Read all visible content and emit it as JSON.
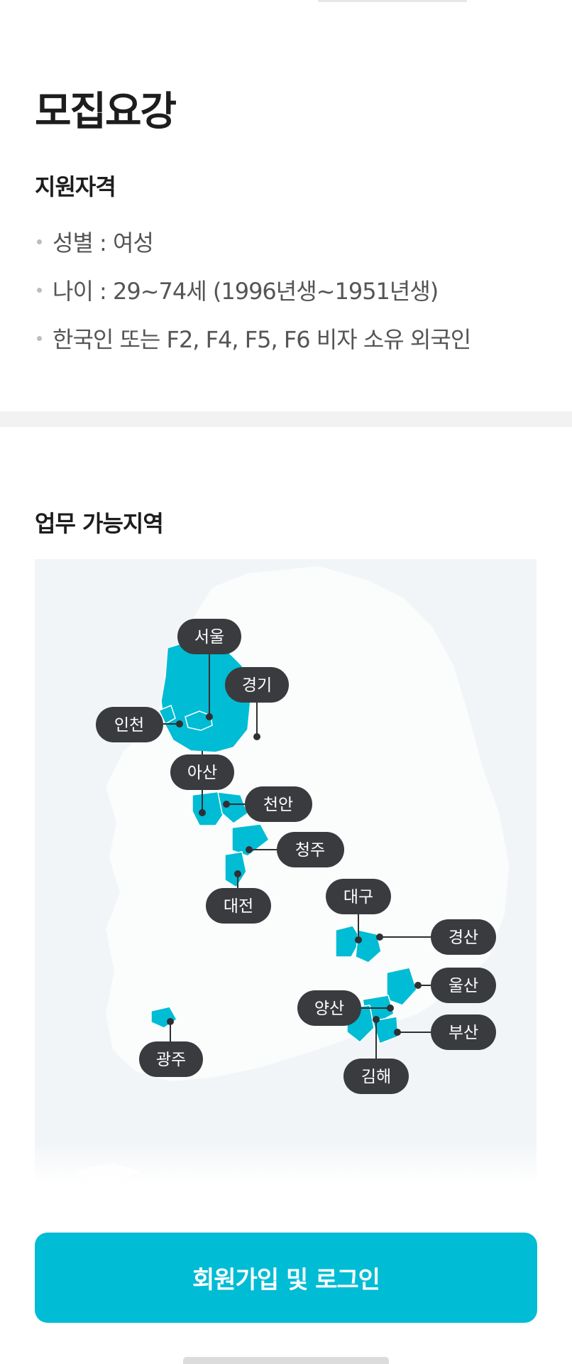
{
  "recruitment": {
    "title": "모집요강",
    "qualification": {
      "heading": "지원자격",
      "items": [
        "성별 : 여성",
        "나이 : 29~74세 (1996년생~1951년생)",
        "한국인 또는 F2, F4, F5, F6 비자 소유 외국인"
      ]
    },
    "work_area": {
      "heading": "업무 가능지역",
      "regions": [
        "서울",
        "경기",
        "인천",
        "아산",
        "천안",
        "청주",
        "대전",
        "대구",
        "경산",
        "울산",
        "양산",
        "부산",
        "김해",
        "광주"
      ]
    }
  },
  "cta": {
    "label": "회원가입 및 로그인"
  },
  "colors": {
    "accent": "#00bcd4",
    "label_bg": "#393b3e",
    "map_bg": "#f2f5f7",
    "divider": "#f2f2f2"
  }
}
